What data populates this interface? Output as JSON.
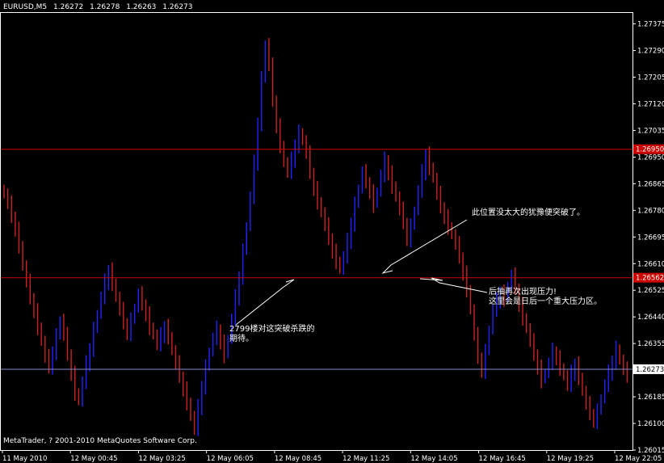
{
  "header": {
    "symbol": "EURUSD,M5",
    "open": "1.26272",
    "high": "1.26278",
    "low": "1.26263",
    "close": "1.26273"
  },
  "footer": {
    "copyright": "MetaTrader, ? 2001-2010 MetaQuotes Software Corp."
  },
  "annotations": {
    "breakout_line1": "此位置没太大的犹豫便突破了。",
    "pressure_line1": "后抽再次出现压力!",
    "pressure_line2": "这里会是日后一个重大压力区。",
    "expect_line1": "2799楼对这突破杀跌的",
    "expect_line2": "期待。"
  },
  "colors": {
    "background": "#000000",
    "bull": "#2222ff",
    "bear": "#cc2222",
    "resistance": "#cc0000",
    "current_price_line": "#8888cc",
    "axis": "#ffffff",
    "red_price_tag": "#cc0000"
  },
  "chart_data": {
    "type": "ohlc",
    "ylim": [
      1.26015,
      1.2741
    ],
    "y_ticks": [
      "1.27375",
      "1.27290",
      "1.27205",
      "1.27120",
      "1.27035",
      "1.26950",
      "1.26865",
      "1.26780",
      "1.26695",
      "1.26610",
      "1.26525",
      "1.26440",
      "1.26355",
      "1.26270",
      "1.26185",
      "1.26100",
      "1.26015"
    ],
    "x_ticks": [
      "11 May 2010",
      "12 May 00:45",
      "12 May 03:25",
      "12 May 06:05",
      "12 May 08:45",
      "12 May 11:25",
      "12 May 14:05",
      "12 May 16:45",
      "12 May 19:25",
      "12 May 22:05"
    ],
    "horizontal_lines": [
      {
        "name": "upper-resistance",
        "price": 1.26975,
        "tag": "1.26950"
      },
      {
        "name": "lower-resistance",
        "price": 1.26565,
        "tag": "1.26562"
      },
      {
        "name": "current-price",
        "price": 1.26273,
        "tag": "1.26273"
      }
    ],
    "closes": [
      1.2683,
      1.268,
      1.2676,
      1.2672,
      1.2667,
      1.266,
      1.2655,
      1.265,
      1.2646,
      1.2641,
      1.2636,
      1.2631,
      1.2628,
      1.2633,
      1.2638,
      1.2643,
      1.2638,
      1.2632,
      1.2626,
      1.262,
      1.2617,
      1.2623,
      1.2629,
      1.2634,
      1.264,
      1.2645,
      1.265,
      1.2655,
      1.2659,
      1.2655,
      1.265,
      1.2646,
      1.2642,
      1.2639,
      1.2643,
      1.2647,
      1.2651,
      1.2648,
      1.2645,
      1.2641,
      1.2638,
      1.2635,
      1.2638,
      1.2641,
      1.2638,
      1.2633,
      1.2629,
      1.2625,
      1.2621,
      1.2617,
      1.2612,
      1.2608,
      1.2615,
      1.2622,
      1.2628,
      1.2633,
      1.2637,
      1.264,
      1.2636,
      1.2632,
      1.2637,
      1.2643,
      1.265,
      1.2657,
      1.2665,
      1.2673,
      1.2682,
      1.2693,
      1.2706,
      1.272,
      1.2731,
      1.2724,
      1.2713,
      1.2705,
      1.2699,
      1.2693,
      1.269,
      1.2694,
      1.2699,
      1.2703,
      1.27,
      1.2696,
      1.269,
      1.2685,
      1.2681,
      1.2677,
      1.2673,
      1.2669,
      1.2665,
      1.2662,
      1.2659,
      1.2663,
      1.2668,
      1.2674,
      1.268,
      1.2685,
      1.269,
      1.2687,
      1.2684,
      1.268,
      1.2684,
      1.2689,
      1.2694,
      1.269,
      1.2686,
      1.2682,
      1.2678,
      1.2674,
      1.2669,
      1.2673,
      1.2678,
      1.2684,
      1.269,
      1.2696,
      1.2692,
      1.2688,
      1.2683,
      1.2679,
      1.2676,
      1.2673,
      1.267,
      1.2667,
      1.2663,
      1.2658,
      1.2653,
      1.2646,
      1.2638,
      1.2631,
      1.2627,
      1.2633,
      1.264,
      1.2646,
      1.2649,
      1.2652,
      1.265,
      1.2654,
      1.2657,
      1.2653,
      1.2648,
      1.2644,
      1.264,
      1.2636,
      1.2632,
      1.2628,
      1.2624,
      1.2626,
      1.2629,
      1.2633,
      1.2631,
      1.2628,
      1.2625,
      1.2622,
      1.2626,
      1.2629,
      1.2625,
      1.262,
      1.2616,
      1.2613,
      1.2611,
      1.2614,
      1.2618,
      1.2622,
      1.2626,
      1.263,
      1.2634,
      1.263,
      1.2627,
      1.2625
    ]
  }
}
